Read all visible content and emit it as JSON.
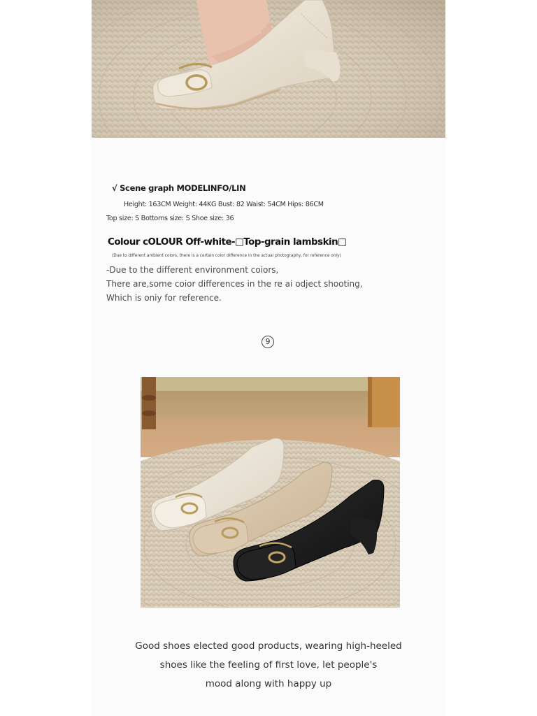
{
  "model_info": {
    "title": "√ Scene graph MODELINFO/LIN",
    "measurements": "Height: 163CM Weight: 44KG Bust: 82 Waist: 54CM Hips: 86CM",
    "sizes": "Top size: S Bottoms size: S Shoe size: 36"
  },
  "colour": {
    "heading": "Colour cOLOUR Off-white-□Top-grain lambskin□",
    "fine_print": "(Due to different ambient colors, there is a certain color difference in the actual photography, for reference only)"
  },
  "note_lines": [
    "-Due to the different environment coiors,",
    "There are,some coior differences in the re ai odject shooting,",
    "Which is oniy for reference."
  ],
  "section_number": "9",
  "caption_lines": [
    "Good shoes elected good products, wearing high-heeled",
    "shoes like the feeling of first love, let people's",
    "mood along with happy up"
  ],
  "colors": {
    "off_white": "#ece5d8",
    "apricot": "#d9c7ab",
    "black": "#1c1c1c",
    "rug": "#d8ccb8",
    "floor": "#c79d73"
  }
}
